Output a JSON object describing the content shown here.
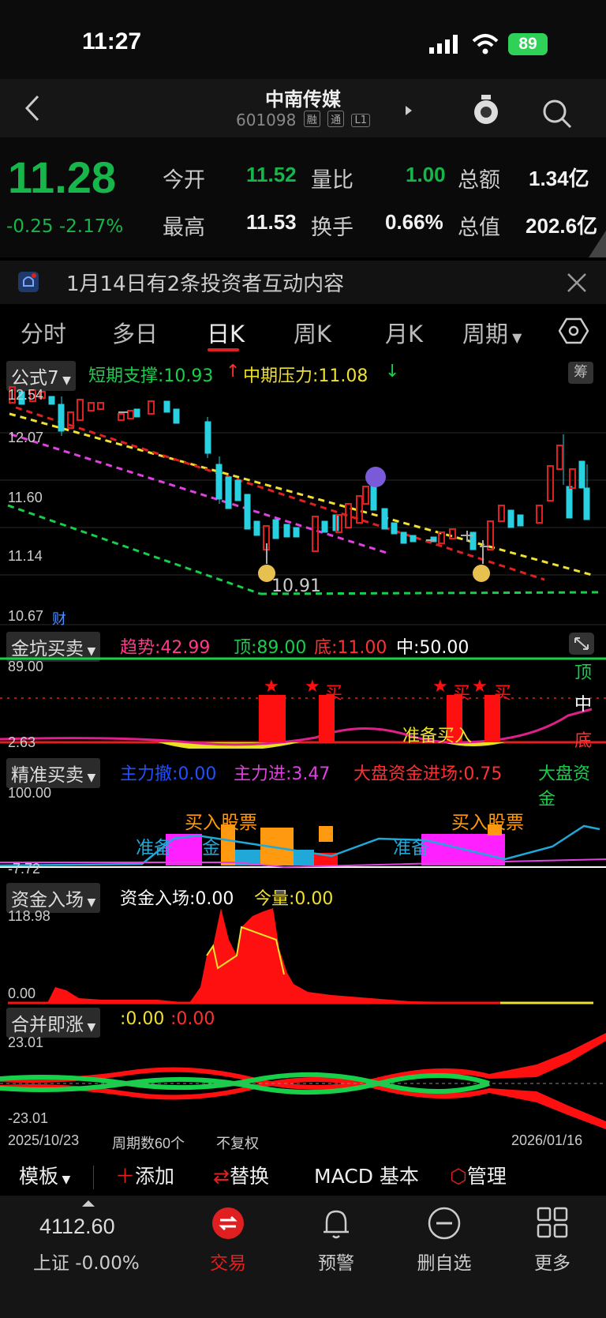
{
  "status_bar": {
    "time": "11:27",
    "battery": "89"
  },
  "header": {
    "title": "中南传媒",
    "code": "601098",
    "tags": [
      "融",
      "通",
      "L1"
    ]
  },
  "quote": {
    "price": "11.28",
    "change": "-0.25",
    "change_pct": "-2.17%",
    "open_label": "今开",
    "open": "11.52",
    "volume_ratio_label": "量比",
    "volume_ratio": "1.00",
    "amount_label": "总额",
    "amount": "1.34亿",
    "high_label": "最高",
    "high": "11.53",
    "turnover_label": "换手",
    "turnover": "0.66%",
    "market_cap_label": "总值",
    "market_cap": "202.6亿"
  },
  "notice": {
    "text": "1月14日有2条投资者互动内容"
  },
  "tabs": [
    "分时",
    "多日",
    "日K",
    "周K",
    "月K",
    "周期"
  ],
  "active_tab": "日K",
  "main_indicator": {
    "label": "公式7",
    "support": "短期支撑:10.93",
    "pressure": "中期压力:11.08",
    "axis": [
      "12.54",
      "12.07",
      "11.60",
      "11.14",
      "10.67"
    ],
    "low_label": "10.91",
    "cai_badge": "财",
    "calc_badge": "筹"
  },
  "ind1": {
    "label": "金坑买卖",
    "trend": "趋势:42.99",
    "top": "顶:89.00",
    "bottom": "底:11.00",
    "mid": "中:50.00",
    "axis_top": "89.00",
    "axis_bottom": "2.63",
    "right_top": "顶",
    "right_mid": "中",
    "right_bottom": "底",
    "buy": "买",
    "prepare": "准备买入"
  },
  "ind2": {
    "label": "精准买卖",
    "s1": "主力撤:0.00",
    "s2": "主力进:3.47",
    "s3": "大盘资金进场:0.75",
    "s4": "大盘资金",
    "axis_top": "100.00",
    "axis_bottom": "-7.72",
    "buy1": "买入股票",
    "buy2": "买入股票",
    "prep1": "准备",
    "prep1b": "金",
    "prep2": "准备"
  },
  "ind3": {
    "label": "资金入场",
    "s1": "资金入场:0.00",
    "s2": "今量:0.00",
    "axis_top": "118.98",
    "axis_bottom": "0.00"
  },
  "ind4": {
    "label": "合并即涨",
    "s1": ":0.00",
    "s2": ":0.00",
    "axis_top": "23.01",
    "axis_bottom": "-23.01"
  },
  "range": {
    "start": "2025/10/23",
    "count": "周期数60个",
    "adjust": "不复权",
    "end": "2026/01/16"
  },
  "toolbar": {
    "template": "模板",
    "add": "添加",
    "replace": "替换",
    "macd": "MACD 基本",
    "manage": "管理"
  },
  "tabbar": {
    "index_value": "4112.60",
    "index_label": "上证 -0.00%",
    "trade": "交易",
    "alert": "预警",
    "remove": "删自选",
    "more": "更多"
  },
  "colors": {
    "up": "#e02020",
    "down": "#2ad0e0",
    "green": "#17b64a",
    "yellow": "#f0e030"
  }
}
